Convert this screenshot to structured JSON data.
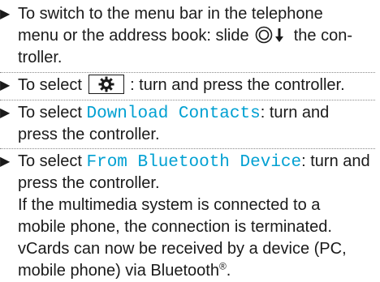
{
  "arrow_glyph": "▶",
  "icons": {
    "controller_slide": "controller-slide-down-icon",
    "settings": "gear-icon"
  },
  "colors": {
    "highlight": "#00a0d2"
  },
  "steps": [
    {
      "line1": "To switch to the menu bar in the telephone",
      "line2": "menu or the address book: slide",
      "line2_after": "the con-",
      "line3": "troller."
    },
    {
      "before_icon": "To select",
      "after_icon": ": turn and press the controller."
    },
    {
      "before": "To select ",
      "highlight": "Download Contacts",
      "after": ": turn and",
      "line2": "press the controller."
    },
    {
      "before": "To select ",
      "highlight": "From Bluetooth Device",
      "after": ": turn and",
      "line2": "press the controller.",
      "note_lines": [
        "If the multimedia system is connected to a",
        "mobile phone, the connection is terminated.",
        "vCards can now be received by a device (PC,"
      ],
      "note_last": "mobile phone) via Bluetooth",
      "note_sup": "®",
      "note_end": "."
    }
  ]
}
